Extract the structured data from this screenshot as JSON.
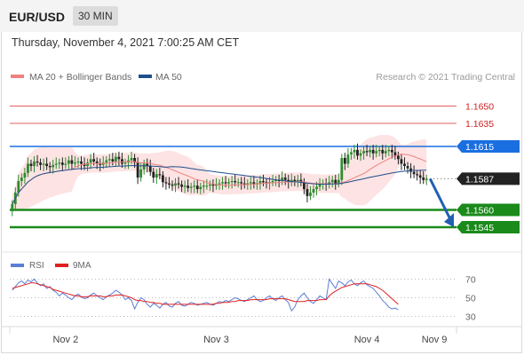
{
  "header": {
    "symbol": "EUR/USD",
    "timeframe": "30 MIN",
    "datetime": "Thursday, November 4, 2021 7:00:25 AM CET"
  },
  "legend": {
    "ma20_label": "MA 20 + Bollinger Bands",
    "ma50_label": "MA 50",
    "copyright": "Research © 2021 Trading Central",
    "rsi_label": "RSI",
    "rsi_ma_label": "9MA"
  },
  "colors": {
    "ma20": "#f08080",
    "ma50": "#1f4e8c",
    "bollinger_fill": "#fde0e0",
    "candle_up": "#2e8b2e",
    "candle_down": "#222222",
    "resistance": "#e06060",
    "pivot": "#1a6fe0",
    "support": "#1a8a1a",
    "current": "#222222",
    "arrow": "#2060b0",
    "rsi": "#5a7fd6",
    "rsi_ma": "#e02020"
  },
  "chart_data": {
    "type": "candlestick",
    "price_ylim": [
      1.1525,
      1.1665
    ],
    "levels": [
      {
        "kind": "resistance",
        "value": 1.165,
        "label": "1.1650"
      },
      {
        "kind": "resistance",
        "value": 1.1635,
        "label": "1.1635"
      },
      {
        "kind": "pivot",
        "value": 1.1615,
        "label": "1.1615"
      },
      {
        "kind": "current",
        "value": 1.1587,
        "label": "1.1587"
      },
      {
        "kind": "support",
        "value": 1.156,
        "label": "1.1560"
      },
      {
        "kind": "support",
        "value": 1.1545,
        "label": "1.1545"
      }
    ],
    "forecast_target": 1.1545,
    "x_tick_labels": [
      "Nov 2",
      "Nov 3",
      "Nov 4",
      "Nov 9"
    ],
    "x_tick_positions": [
      17.5,
      65.5,
      113.5,
      135
    ],
    "close_series": [
      1.1565,
      1.1575,
      1.1585,
      1.1588,
      1.1592,
      1.16,
      1.1598,
      1.1602,
      1.1601,
      1.1599,
      1.16,
      1.1598,
      1.1597,
      1.1599,
      1.16,
      1.1601,
      1.1599,
      1.16,
      1.1603,
      1.16,
      1.1601,
      1.1602,
      1.16,
      1.1598,
      1.1601,
      1.1604,
      1.1602,
      1.16,
      1.1599,
      1.1601,
      1.1603,
      1.1604,
      1.1602,
      1.1606,
      1.1604,
      1.16,
      1.1601,
      1.1603,
      1.1605,
      1.1601,
      1.1588,
      1.1595,
      1.16,
      1.1598,
      1.1593,
      1.1588,
      1.1591,
      1.159,
      1.1584,
      1.1583,
      1.1582,
      1.1581,
      1.1583,
      1.1582,
      1.158,
      1.1581,
      1.1579,
      1.158,
      1.1581,
      1.1578,
      1.158,
      1.1581,
      1.1581,
      1.1582,
      1.1581,
      1.1582,
      1.1583,
      1.1584,
      1.1583,
      1.1584,
      1.1585,
      1.1584,
      1.1584,
      1.1583,
      1.1582,
      1.1583,
      1.1584,
      1.1582,
      1.1583,
      1.1585,
      1.1584,
      1.1583,
      1.1584,
      1.1585,
      1.1586,
      1.1585,
      1.1588,
      1.1586,
      1.1584,
      1.1586,
      1.1585,
      1.1586,
      1.1584,
      1.1578,
      1.1572,
      1.1575,
      1.1578,
      1.158,
      1.1582,
      1.1583,
      1.1582,
      1.1584,
      1.1586,
      1.1583,
      1.1586,
      1.1605,
      1.16,
      1.1608,
      1.161,
      1.1612,
      1.1607,
      1.1609,
      1.1611,
      1.161,
      1.1612,
      1.1609,
      1.1611,
      1.1612,
      1.1609,
      1.1611,
      1.1612,
      1.161,
      1.1607,
      1.1604,
      1.16,
      1.1598,
      1.1596,
      1.1593,
      1.1591,
      1.159,
      1.1588,
      1.1586,
      1.1587
    ],
    "rsi_ylim": [
      20,
      80
    ],
    "rsi_ticks": [
      70,
      50,
      30
    ],
    "rsi_series": [
      58,
      62,
      66,
      68,
      65,
      69,
      67,
      70,
      66,
      63,
      65,
      60,
      62,
      58,
      56,
      52,
      55,
      53,
      50,
      48,
      52,
      54,
      51,
      49,
      50,
      53,
      55,
      52,
      50,
      48,
      51,
      53,
      55,
      58,
      56,
      53,
      48,
      50,
      47,
      38,
      45,
      50,
      48,
      43,
      40,
      44,
      42,
      39,
      43,
      45,
      41,
      40,
      44,
      46,
      42,
      41,
      43,
      45,
      44,
      42,
      43,
      44,
      45,
      43,
      42,
      44,
      46,
      45,
      47,
      46,
      48,
      50,
      49,
      47,
      46,
      48,
      50,
      52,
      48,
      46,
      47,
      50,
      52,
      49,
      47,
      50,
      52,
      48,
      45,
      36,
      40,
      48,
      52,
      55,
      50,
      46,
      44,
      48,
      52,
      50,
      48,
      70,
      65,
      60,
      68,
      66,
      63,
      67,
      69,
      65,
      63,
      66,
      68,
      64,
      62,
      60,
      56,
      52,
      47,
      44,
      40,
      38,
      39,
      37
    ],
    "rsi_ma_series": [
      60,
      61,
      62,
      63,
      64,
      65,
      66,
      66,
      65,
      64,
      63,
      62,
      61,
      59,
      58,
      57,
      56,
      55,
      54,
      53,
      52,
      52,
      51,
      51,
      51,
      52,
      52,
      52,
      52,
      51,
      51,
      52,
      52,
      53,
      53,
      53,
      52,
      51,
      50,
      48,
      47,
      47,
      46,
      46,
      45,
      45,
      44,
      44,
      43,
      43,
      43,
      43,
      43,
      43,
      43,
      43,
      43,
      43,
      43,
      43,
      43,
      43,
      43,
      43,
      43,
      44,
      44,
      45,
      45,
      45,
      46,
      46,
      47,
      47,
      47,
      47,
      48,
      48,
      48,
      48,
      48,
      48,
      49,
      49,
      49,
      49,
      49,
      49,
      48,
      47,
      46,
      46,
      46,
      46,
      47,
      47,
      47,
      47,
      48,
      48,
      48,
      52,
      55,
      57,
      59,
      61,
      62,
      63,
      64,
      65,
      65,
      65,
      65,
      65,
      64,
      63,
      62,
      60,
      58,
      55,
      52,
      49,
      46,
      43
    ]
  }
}
